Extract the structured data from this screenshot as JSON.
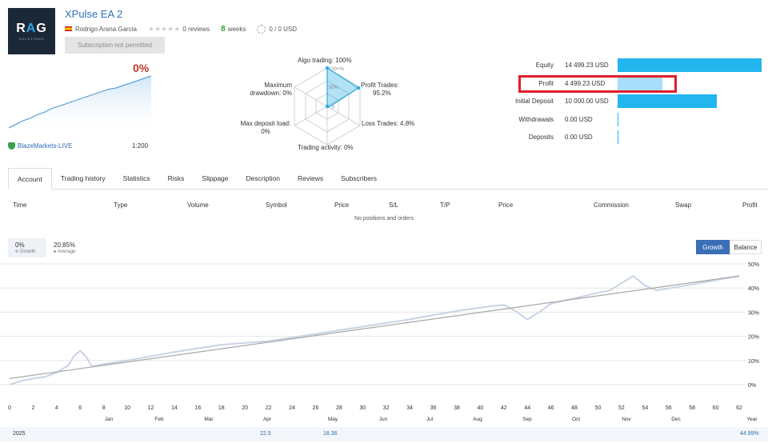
{
  "product": {
    "logo_text": "RAG",
    "logo_sub": "SOLUTIONS",
    "title": "XPulse EA 2",
    "author": "Rodrigo Arana Garcia",
    "reviews": "0 reviews",
    "weeks_number": "8",
    "weeks_label": "weeks",
    "subscribers": "0 / 0 USD",
    "subscribe_button": "Subscription not permitted"
  },
  "summary": {
    "growth": "0%",
    "broker": "BlazeMarkets-LIVE",
    "leverage": "1:200"
  },
  "radar": {
    "algo": "Algo trading: 100%",
    "ring_100": "100+%",
    "ring_50": "50%",
    "ring_0": "0",
    "profit_trades": [
      "Profit Trades:",
      "95.2%"
    ],
    "loss_trades": "Loss Trades: 4.8%",
    "activity": "Trading activity: 0%",
    "deposit_load": [
      "Max deposit load:",
      "0%"
    ],
    "drawdown": [
      "Maximum",
      "drawdown: 0%"
    ]
  },
  "balance_bars": {
    "max_value": 14499.23,
    "rows": [
      {
        "label": "Equity",
        "value_text": "14 499.23 USD",
        "value": 14499.23,
        "color": "#22b5ee"
      },
      {
        "label": "Profit",
        "value_text": "4 499.23 USD",
        "value": 4499.23,
        "color": "#a8defa"
      },
      {
        "label": "Initial Deposit",
        "value_text": "10 000.00 USD",
        "value": 10000.0,
        "color": "#22b5ee"
      },
      {
        "label": "Withdrawals",
        "value_text": "0.00 USD",
        "value": 0,
        "color": "#22b5ee"
      },
      {
        "label": "Deposits",
        "value_text": "0.00 USD",
        "value": 0,
        "color": "#22b5ee"
      }
    ]
  },
  "tabs": [
    "Account",
    "Trading history",
    "Statistics",
    "Risks",
    "Slippage",
    "Description",
    "Reviews",
    "Subscribers"
  ],
  "table": {
    "columns": [
      "Time",
      "Type",
      "Volume",
      "Symbol",
      "Price",
      "S/L",
      "T/P",
      "Price",
      "Commission",
      "Swap",
      "Profit"
    ],
    "empty_text": "No positions and orders"
  },
  "growth_panel": {
    "current_value": "0%",
    "current_label": "Growth",
    "average_value": "20.85%",
    "average_label": "Average",
    "btn_growth": "Growth",
    "btn_balance": "Balance"
  },
  "chart_data": {
    "type": "line",
    "title": "",
    "xlabel": "",
    "ylabel": "",
    "x_ticks": [
      "0",
      "2",
      "4",
      "6",
      "8",
      "10",
      "12",
      "14",
      "16",
      "18",
      "20",
      "22",
      "24",
      "26",
      "28",
      "30",
      "32",
      "34",
      "36",
      "38",
      "40",
      "42",
      "44",
      "46",
      "48",
      "50",
      "52",
      "54",
      "56",
      "58",
      "60",
      "62"
    ],
    "month_labels": [
      "Jan",
      "Feb",
      "Mar",
      "Apr",
      "May",
      "Jun",
      "Jul",
      "Aug",
      "Sep",
      "Oct",
      "Nov",
      "Dec",
      "Year"
    ],
    "y_ticks": [
      "50%",
      "40%",
      "30%",
      "20%",
      "10%",
      "0%"
    ],
    "xlim": [
      0,
      62
    ],
    "ylim": [
      -2,
      50
    ],
    "series": [
      {
        "color": "#c9d3e6",
        "x": [
          0,
          1,
          2,
          3,
          4,
          5,
          5.5,
          6,
          6.5,
          7,
          8,
          10,
          14,
          18,
          22,
          26,
          30,
          34,
          38,
          41,
          42,
          43,
          44,
          45,
          46,
          50,
          51,
          52,
          53,
          54,
          55,
          58,
          62
        ],
        "y": [
          0,
          1.5,
          2.5,
          3.2,
          5.0,
          8.0,
          12.0,
          14.0,
          11.5,
          7.5,
          8.5,
          10.0,
          13.5,
          16.5,
          18.0,
          21.0,
          24.0,
          27.0,
          30.5,
          32.5,
          33.0,
          30.5,
          27.0,
          30.0,
          33.5,
          38.0,
          39.0,
          42.0,
          45.0,
          41.0,
          39.0,
          41.5,
          45.0
        ]
      },
      {
        "color": "#a7a7a7",
        "x": [
          0,
          62
        ],
        "y": [
          2.5,
          45.0
        ]
      }
    ],
    "footer": {
      "year": "2025",
      "values": [
        "22.5",
        "18.36"
      ],
      "total": "44.99%"
    }
  },
  "mini_chart": {
    "x": [
      0,
      1,
      2,
      3,
      4,
      5,
      6,
      7,
      8,
      9,
      10,
      11,
      12,
      13,
      14,
      15,
      16,
      17,
      18,
      19,
      20
    ],
    "y": [
      0,
      3,
      6,
      8,
      11,
      13,
      16,
      18,
      20,
      22,
      24,
      26,
      28,
      30,
      32,
      33,
      35,
      37,
      39,
      41,
      43
    ]
  },
  "colors": {
    "accent": "#2e6fb7",
    "bar": "#22b5ee",
    "bar_light": "#a8defa",
    "highlight": "#e11e2b",
    "growth_red": "#c0392b",
    "weeks_green": "#2ca02c"
  }
}
